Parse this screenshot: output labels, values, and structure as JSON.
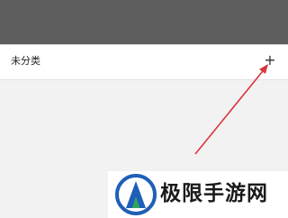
{
  "header": {},
  "category_list": {
    "label": "未分类",
    "add_glyph": "+",
    "add_icon": "plus-icon"
  },
  "annotation": {
    "arrow_color": "#d9363e"
  },
  "watermark": {
    "text": "极限手游网",
    "logo_colors": [
      "#1e5fb8",
      "#2fa84f"
    ]
  }
}
